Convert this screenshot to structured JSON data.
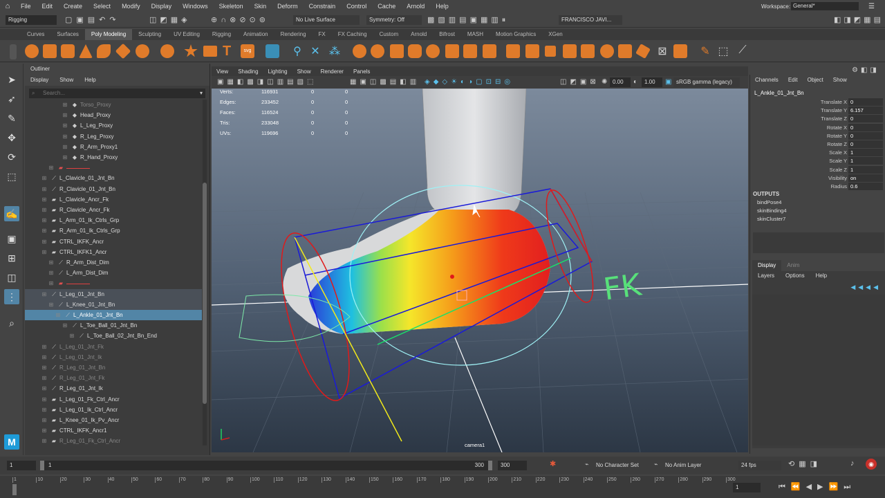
{
  "menubar": {
    "items": [
      "File",
      "Edit",
      "Create",
      "Select",
      "Modify",
      "Display",
      "Windows",
      "Skeleton",
      "Skin",
      "Deform",
      "Constrain",
      "Control",
      "Cache",
      "Arnold",
      "Help"
    ],
    "workspace_label": "Workspace:",
    "workspace_value": "General*"
  },
  "status": {
    "mode": "Rigging",
    "live_surface": "No Live Surface",
    "symmetry": "Symmetry: Off",
    "user": "FRANCISCO JAVI..."
  },
  "shelf_tabs": [
    "Curves",
    "Surfaces",
    "Poly Modeling",
    "Sculpting",
    "UV Editing",
    "Rigging",
    "Animation",
    "Rendering",
    "FX",
    "FX Caching",
    "Custom",
    "Arnold",
    "Bifrost",
    "MASH",
    "Motion Graphics",
    "XGen"
  ],
  "shelf_active": "Poly Modeling",
  "outliner": {
    "title": "Outliner",
    "menu": [
      "Display",
      "Show",
      "Help"
    ],
    "search_placeholder": "Search...",
    "rows": [
      {
        "label": "Torso_Proxy",
        "indent": 4,
        "icon": "◆",
        "style": "grey"
      },
      {
        "label": "Head_Proxy",
        "indent": 4,
        "icon": "◆",
        "style": ""
      },
      {
        "label": "L_Leg_Proxy",
        "indent": 4,
        "icon": "◆",
        "style": ""
      },
      {
        "label": "R_Leg_Proxy",
        "indent": 4,
        "icon": "◆",
        "style": ""
      },
      {
        "label": "R_Arm_Proxy1",
        "indent": 4,
        "icon": "◆",
        "style": ""
      },
      {
        "label": "R_Hand_Proxy",
        "indent": 4,
        "icon": "◆",
        "style": ""
      },
      {
        "label": "",
        "indent": 2,
        "icon": "▰",
        "style": "red"
      },
      {
        "label": "L_Clavicle_01_Jnt_Bn",
        "indent": 1,
        "icon": "⟋",
        "style": ""
      },
      {
        "label": "R_Clavicle_01_Jnt_Bn",
        "indent": 1,
        "icon": "⟋",
        "style": ""
      },
      {
        "label": "L_Clavicle_Ancr_Fk",
        "indent": 1,
        "icon": "▰",
        "style": ""
      },
      {
        "label": "R_Clavicle_Ancr_Fk",
        "indent": 1,
        "icon": "▰",
        "style": ""
      },
      {
        "label": "L_Arm_01_Ik_Ctrls_Grp",
        "indent": 1,
        "icon": "▰",
        "style": ""
      },
      {
        "label": "R_Arm_01_Ik_Ctrls_Grp",
        "indent": 1,
        "icon": "▰",
        "style": ""
      },
      {
        "label": "CTRL_IKFK_Ancr",
        "indent": 1,
        "icon": "▰",
        "style": ""
      },
      {
        "label": "CTRL_IKFK1_Ancr",
        "indent": 1,
        "icon": "▰",
        "style": ""
      },
      {
        "label": "R_Arm_Dist_Dim",
        "indent": 2,
        "icon": "⟋",
        "style": ""
      },
      {
        "label": "L_Arm_Dist_Dim",
        "indent": 2,
        "icon": "⟋",
        "style": ""
      },
      {
        "label": "",
        "indent": 2,
        "icon": "▰",
        "style": "red"
      },
      {
        "label": "L_Leg_01_Jnt_Bn",
        "indent": 1,
        "icon": "⟋",
        "style": "hi"
      },
      {
        "label": "L_Knee_01_Jnt_Bn",
        "indent": 2,
        "icon": "⟋",
        "style": "hi"
      },
      {
        "label": "L_Ankle_01_Jnt_Bn",
        "indent": 3,
        "icon": "⟋",
        "style": "sel"
      },
      {
        "label": "L_Toe_Ball_01_Jnt_Bn",
        "indent": 4,
        "icon": "⟋",
        "style": ""
      },
      {
        "label": "L_Toe_Ball_02_Jnt_Bn_End",
        "indent": 5,
        "icon": "⟋",
        "style": ""
      },
      {
        "label": "L_Leg_01_Jnt_Fk",
        "indent": 1,
        "icon": "⟋",
        "style": "grey"
      },
      {
        "label": "L_Leg_01_Jnt_Ik",
        "indent": 1,
        "icon": "⟋",
        "style": "grey"
      },
      {
        "label": "R_Leg_01_Jnt_Bn",
        "indent": 1,
        "icon": "⟋",
        "style": "grey"
      },
      {
        "label": "R_Leg_01_Jnt_Fk",
        "indent": 1,
        "icon": "⟋",
        "style": "grey"
      },
      {
        "label": "R_Leg_01_Jnt_Ik",
        "indent": 1,
        "icon": "⟋",
        "style": ""
      },
      {
        "label": "L_Leg_01_Fk_Ctrl_Ancr",
        "indent": 1,
        "icon": "▰",
        "style": ""
      },
      {
        "label": "L_Leg_01_Ik_Ctrl_Ancr",
        "indent": 1,
        "icon": "▰",
        "style": ""
      },
      {
        "label": "L_Knee_01_Ik_Pv_Ancr",
        "indent": 1,
        "icon": "▰",
        "style": ""
      },
      {
        "label": "CTRL_IKFK_Ancr1",
        "indent": 1,
        "icon": "▰",
        "style": ""
      },
      {
        "label": "R_Leg_01_Fk_Ctrl_Ancr",
        "indent": 1,
        "icon": "▰",
        "style": "grey"
      }
    ]
  },
  "viewport": {
    "menu": [
      "View",
      "Shading",
      "Lighting",
      "Show",
      "Renderer",
      "Panels"
    ],
    "field_a": "0.00",
    "field_b": "1.00",
    "colorspace": "sRGB gamma (legacy)",
    "hud": [
      {
        "label": "Verts:",
        "a": "116931",
        "b": "0",
        "c": "0"
      },
      {
        "label": "Edges:",
        "a": "233452",
        "b": "0",
        "c": "0"
      },
      {
        "label": "Faces:",
        "a": "116524",
        "b": "0",
        "c": "0"
      },
      {
        "label": "Tris:",
        "a": "233048",
        "b": "0",
        "c": "0"
      },
      {
        "label": "UVs:",
        "a": "119696",
        "b": "0",
        "c": "0"
      }
    ],
    "camera": "camera1",
    "fk_label": "FK"
  },
  "channel_box": {
    "menu": [
      "Channels",
      "Edit",
      "Object",
      "Show"
    ],
    "node": "L_Ankle_01_Jnt_Bn",
    "attrs": [
      {
        "name": "Translate X",
        "value": "0"
      },
      {
        "name": "Translate Y",
        "value": "6.157"
      },
      {
        "name": "Translate Z",
        "value": "0"
      },
      {
        "name": "Rotate X",
        "value": "0"
      },
      {
        "name": "Rotate Y",
        "value": "0"
      },
      {
        "name": "Rotate Z",
        "value": "0"
      },
      {
        "name": "Scale X",
        "value": "1"
      },
      {
        "name": "Scale Y",
        "value": "1"
      },
      {
        "name": "Scale Z",
        "value": "1"
      },
      {
        "name": "Visibility",
        "value": "on"
      },
      {
        "name": "Radius",
        "value": "0.6"
      }
    ],
    "outputs_title": "OUTPUTS",
    "outputs": [
      "bindPose4",
      "skinBinding4",
      "skinCluster7"
    ]
  },
  "layers": {
    "tabs": [
      "Display",
      "Anim"
    ],
    "menu": [
      "Layers",
      "Options",
      "Help"
    ]
  },
  "timeline": {
    "start": "1",
    "inner_start": "1",
    "inner_end": "300",
    "end": "300",
    "char_set": "No Character Set",
    "anim_layer": "No Anim Layer",
    "fps": "24 fps",
    "current": "1",
    "ticks": [
      "1",
      "10",
      "20",
      "30",
      "40",
      "50",
      "60",
      "70",
      "80",
      "90",
      "100",
      "110",
      "120",
      "130",
      "140",
      "150",
      "160",
      "170",
      "180",
      "190",
      "200",
      "210",
      "220",
      "230",
      "240",
      "250",
      "260",
      "270",
      "280",
      "290",
      "300"
    ]
  },
  "colors": {
    "selection": "#5285a6",
    "accent": "#1e9bd8"
  }
}
